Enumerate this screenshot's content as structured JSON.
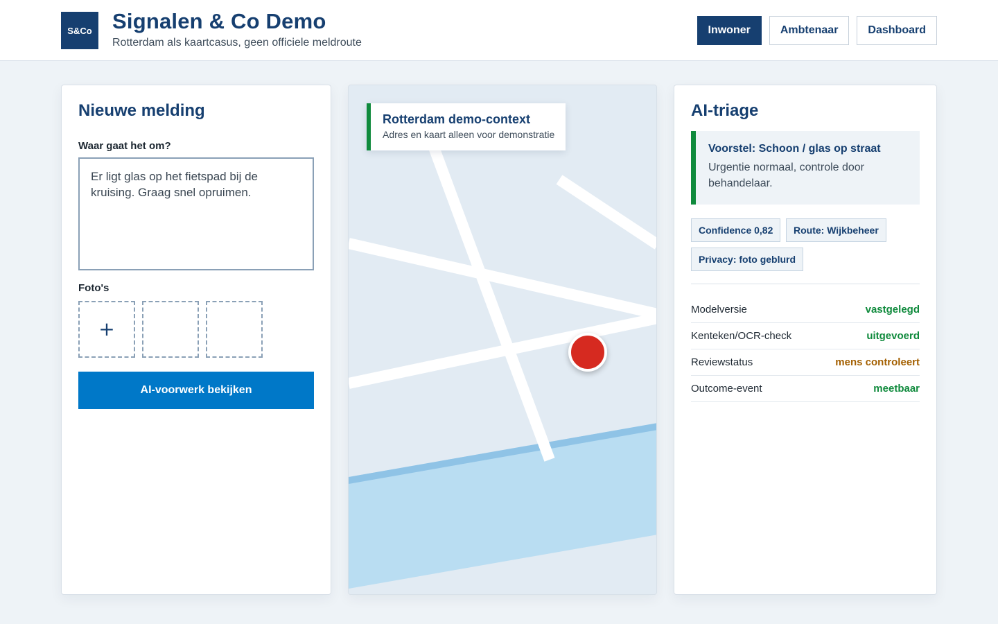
{
  "header": {
    "logo_text": "S&Co",
    "title": "Signalen & Co Demo",
    "subtitle": "Rotterdam als kaartcasus, geen officiele meldroute",
    "nav": [
      {
        "label": "Inwoner",
        "active": true
      },
      {
        "label": "Ambtenaar",
        "active": false
      },
      {
        "label": "Dashboard",
        "active": false
      }
    ]
  },
  "report": {
    "title": "Nieuwe melding",
    "question_label": "Waar gaat het om?",
    "description": "Er ligt glas op het fietspad bij de kruising. Graag snel opruimen.",
    "photos_label": "Foto's",
    "add_photo_symbol": "+",
    "submit_label": "AI-voorwerk bekijken"
  },
  "map": {
    "card_title": "Rotterdam demo-context",
    "card_subtitle": "Adres en kaart alleen voor demonstratie",
    "pin_icon": "location-pin-icon",
    "colors": {
      "land": "#e2ebf3",
      "road": "#ffffff",
      "water": "#b9ddf2",
      "water_edge": "#8fc3e6",
      "pin": "#d62a20"
    }
  },
  "triage": {
    "title": "AI-triage",
    "proposal_title": "Voorstel: Schoon / glas op straat",
    "proposal_text": "Urgentie normaal, controle door behandelaar.",
    "chips": [
      "Confidence 0,82",
      "Route: Wijkbeheer",
      "Privacy: foto geblurd"
    ],
    "checks": [
      {
        "label": "Modelversie",
        "value": "vastgelegd",
        "color": "#0f8a3c"
      },
      {
        "label": "Kenteken/OCR-check",
        "value": "uitgevoerd",
        "color": "#0f8a3c"
      },
      {
        "label": "Reviewstatus",
        "value": "mens controleert",
        "color": "#a35f00"
      },
      {
        "label": "Outcome-event",
        "value": "meetbaar",
        "color": "#0f8a3c"
      }
    ]
  },
  "colors": {
    "brand": "#163f70",
    "primary": "#0078c8",
    "success": "#0f8a3c",
    "warning": "#a35f00"
  }
}
